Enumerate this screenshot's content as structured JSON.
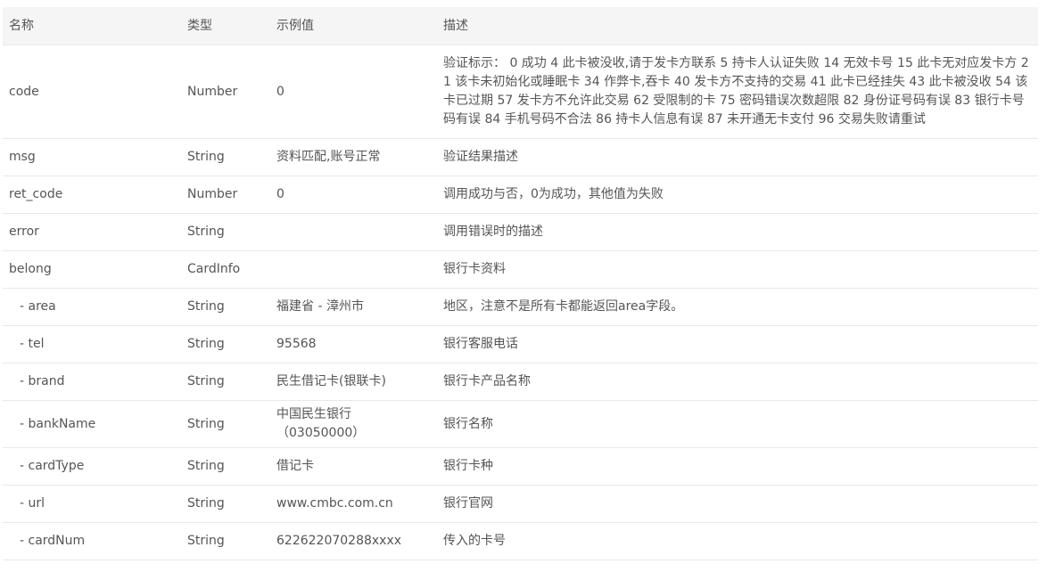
{
  "header": {
    "name": "名称",
    "type": "类型",
    "example": "示例值",
    "desc": "描述"
  },
  "rows": [
    {
      "name": "code",
      "type": "Number",
      "example": "0",
      "desc": "验证标示： 0 成功 4 此卡被没收,请于发卡方联系 5 持卡人认证失败 14 无效卡号 15 此卡无对应发卡方 21 该卡未初始化或睡眠卡 34 作弊卡,吞卡 40 发卡方不支持的交易 41 此卡已经挂失 43 此卡被没收 54 该卡已过期 57 发卡方不允许此交易 62 受限制的卡 75 密码错误次数超限 82 身份证号码有误 83 银行卡号码有误 84 手机号码不合法 86 持卡人信息有误 87 未开通无卡支付 96 交易失败请重试"
    },
    {
      "name": "msg",
      "type": "String",
      "example": "资料匹配,账号正常",
      "desc": "验证结果描述"
    },
    {
      "name": "ret_code",
      "type": "Number",
      "example": "0",
      "desc": "调用成功与否，0为成功，其他值为失败"
    },
    {
      "name": "error",
      "type": "String",
      "example": "",
      "desc": "调用错误时的描述"
    },
    {
      "name": "belong",
      "type": "CardInfo",
      "example": "",
      "desc": "银行卡资料"
    },
    {
      "name": "- area",
      "type": "String",
      "example": "福建省 - 漳州市",
      "desc": "地区，注意不是所有卡都能返回area字段。"
    },
    {
      "name": "- tel",
      "type": "String",
      "example": "95568",
      "desc": "银行客服电话"
    },
    {
      "name": "- brand",
      "type": "String",
      "example": "民生借记卡(银联卡)",
      "desc": "银行卡产品名称"
    },
    {
      "name": "- bankName",
      "type": "String",
      "example_line1": "中国民生银行",
      "example_line2": "（03050000）",
      "desc": "银行名称"
    },
    {
      "name": "- cardType",
      "type": "String",
      "example": "借记卡",
      "desc": "银行卡种"
    },
    {
      "name": "- url",
      "type": "String",
      "example": "www.cmbc.com.cn",
      "desc": "银行官网"
    },
    {
      "name": "- cardNum",
      "type": "String",
      "example": "622622070288xxxx",
      "desc": "传入的卡号"
    }
  ]
}
